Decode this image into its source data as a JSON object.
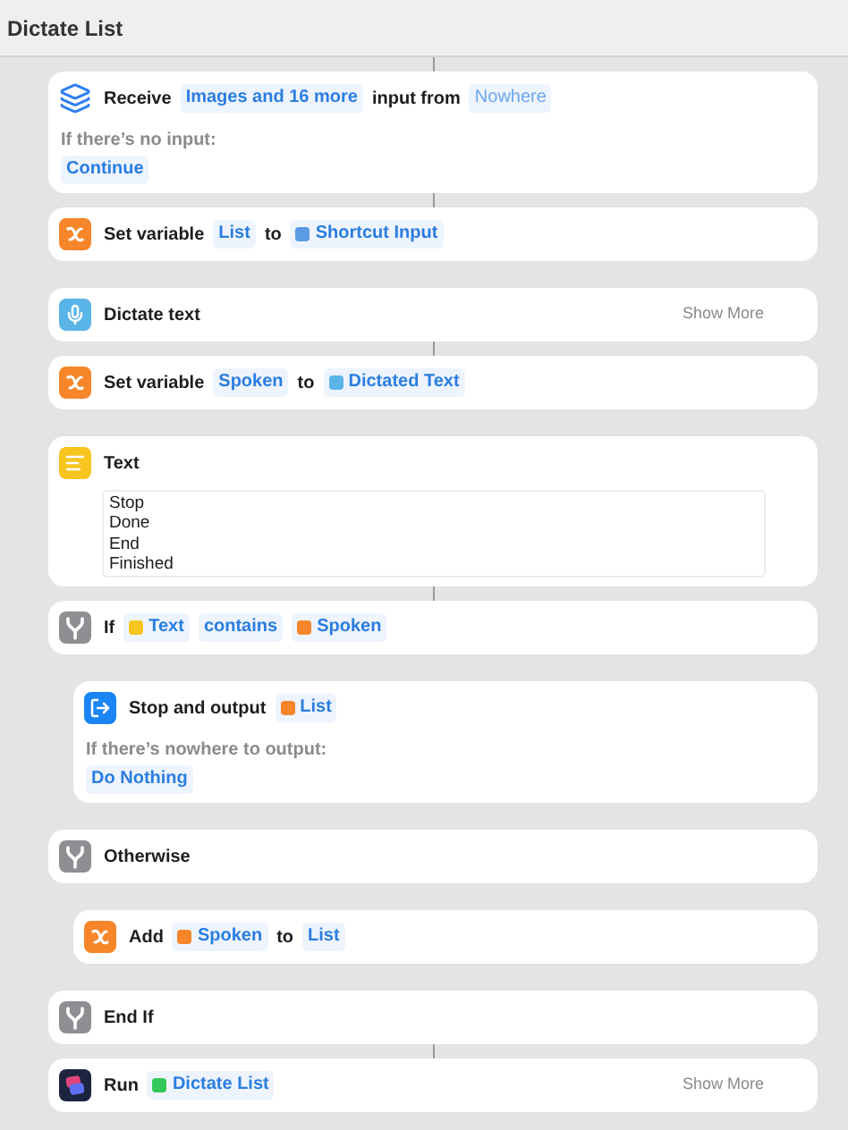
{
  "window": {
    "title": "Dictate List"
  },
  "actions": [
    {
      "kind": "receive",
      "connected": true,
      "parts": [
        {
          "kind": "text",
          "text": "Receive"
        },
        {
          "kind": "token",
          "text": "Images and 16 more"
        },
        {
          "kind": "text",
          "text": "input from"
        },
        {
          "kind": "placeholder",
          "text": "Nowhere"
        }
      ],
      "option": {
        "label": "If there’s no input:",
        "value": "Continue"
      }
    },
    {
      "kind": "variable",
      "connected": true,
      "parts": [
        {
          "kind": "text",
          "text": "Set variable"
        },
        {
          "kind": "token",
          "text": "List"
        },
        {
          "kind": "text",
          "text": "to"
        },
        {
          "kind": "var",
          "text": "Shortcut Input",
          "color": "#5b9be6"
        }
      ]
    },
    {
      "kind": "dictate",
      "connected": false,
      "parts": [
        {
          "kind": "text",
          "text": "Dictate text"
        }
      ],
      "show_more": "Show More"
    },
    {
      "kind": "variable",
      "connected": true,
      "parts": [
        {
          "kind": "text",
          "text": "Set variable"
        },
        {
          "kind": "token",
          "text": "Spoken"
        },
        {
          "kind": "text",
          "text": "to"
        },
        {
          "kind": "var",
          "text": "Dictated Text",
          "color": "#5ab4e8"
        }
      ]
    },
    {
      "kind": "text",
      "connected": false,
      "parts": [
        {
          "kind": "text",
          "text": "Text"
        }
      ],
      "body": [
        "Stop",
        "Done",
        "End",
        "Finished"
      ]
    },
    {
      "kind": "branch",
      "connected": true,
      "parts": [
        {
          "kind": "text",
          "text": "If"
        },
        {
          "kind": "var",
          "text": "Text",
          "color": "#f7c51e"
        },
        {
          "kind": "token",
          "text": "contains"
        },
        {
          "kind": "var",
          "text": "Spoken",
          "color": "#f7862a"
        }
      ],
      "children": [
        {
          "kind": "output",
          "connected": false,
          "parts": [
            {
              "kind": "text",
              "text": "Stop and output"
            },
            {
              "kind": "var",
              "text": "List",
              "color": "#f7862a"
            }
          ],
          "option": {
            "label": "If there’s nowhere to output:",
            "value": "Do Nothing"
          }
        }
      ]
    },
    {
      "kind": "branch",
      "connected": false,
      "parts": [
        {
          "kind": "text",
          "text": "Otherwise"
        }
      ],
      "children": [
        {
          "kind": "variable",
          "connected": false,
          "parts": [
            {
              "kind": "text",
              "text": "Add"
            },
            {
              "kind": "var",
              "text": "Spoken",
              "color": "#f7862a"
            },
            {
              "kind": "text",
              "text": "to"
            },
            {
              "kind": "token",
              "text": "List"
            }
          ]
        }
      ]
    },
    {
      "kind": "branch",
      "connected": false,
      "parts": [
        {
          "kind": "text",
          "text": "End If"
        }
      ]
    },
    {
      "kind": "shortcuts",
      "connected": true,
      "parts": [
        {
          "kind": "text",
          "text": "Run"
        },
        {
          "kind": "var",
          "text": "Dictate List",
          "color": "#34c759"
        }
      ],
      "show_more": "Show More"
    }
  ]
}
